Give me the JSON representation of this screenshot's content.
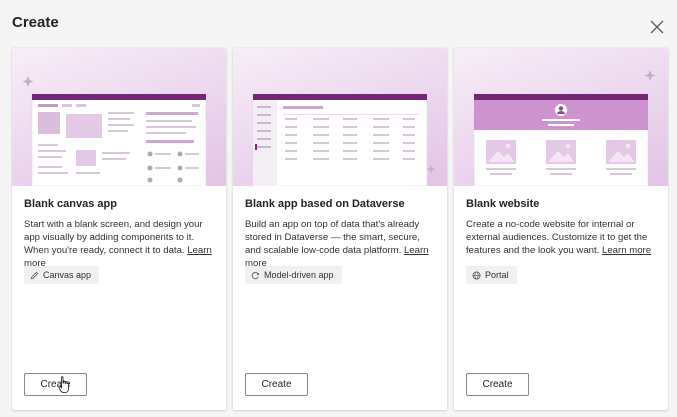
{
  "dialog": {
    "title": "Create",
    "close_label": "Close"
  },
  "cards": [
    {
      "title": "Blank canvas app",
      "description": "Start with a blank screen, and design your app visually by adding components to it. When you're ready, connect it to data.",
      "learn_more": "Learn more",
      "tag_label": "Canvas app",
      "tag_icon": "pencil-icon",
      "create_label": "Create"
    },
    {
      "title": "Blank app based on Dataverse",
      "description": "Build an app on top of data that's already stored in Dataverse — the smart, secure, and scalable low-code data platform.",
      "learn_more": "Learn more",
      "tag_label": "Model-driven app",
      "tag_icon": "model-driven-icon",
      "create_label": "Create"
    },
    {
      "title": "Blank website",
      "description": "Create a no-code website for internal or external audiences. Customize it to get the features and the look you want.",
      "learn_more": "Learn more",
      "tag_label": "Portal",
      "tag_icon": "globe-icon",
      "create_label": "Create"
    }
  ],
  "colors": {
    "accent": "#742774",
    "hero_light": "#f7eef8",
    "hero_dark": "#e2c4e5",
    "button_border": "#8a8886"
  }
}
